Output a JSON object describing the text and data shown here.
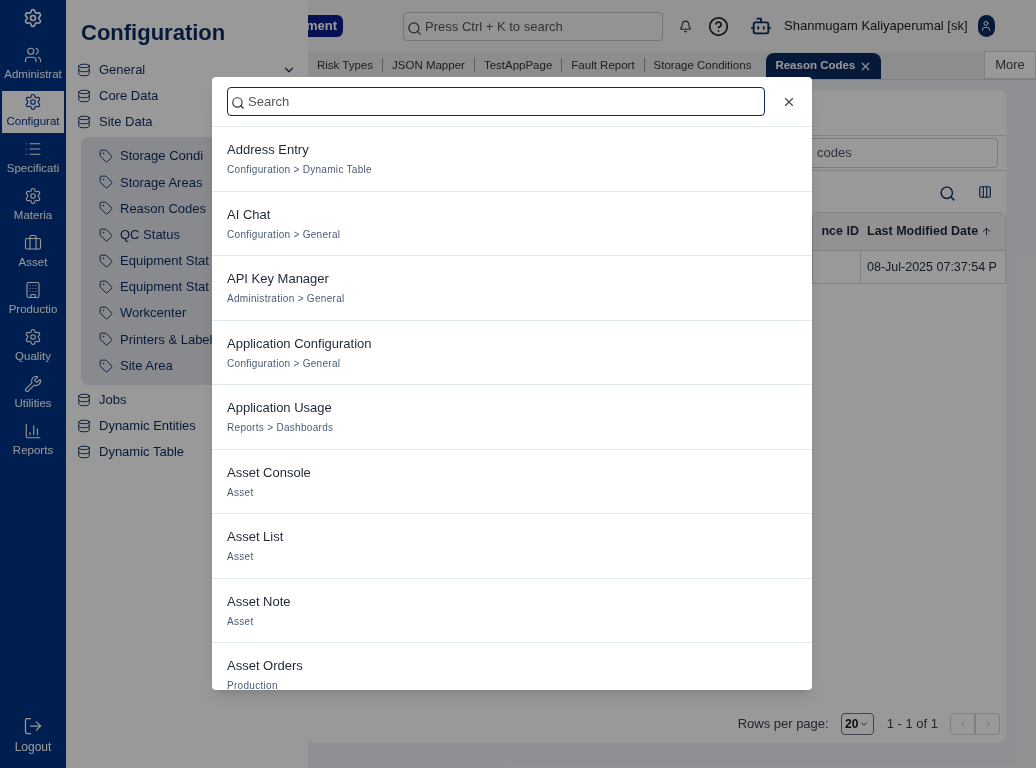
{
  "rail": {
    "items": [
      {
        "label": "Administrat",
        "selected": false
      },
      {
        "label": "Configurat",
        "selected": true
      },
      {
        "label": "Specificati",
        "selected": false
      },
      {
        "label": "Materia",
        "selected": false
      },
      {
        "label": "Asset",
        "selected": false
      },
      {
        "label": "Productio",
        "selected": false
      },
      {
        "label": "Quality",
        "selected": false
      },
      {
        "label": "Utilities",
        "selected": false
      },
      {
        "label": "Reports",
        "selected": false
      }
    ],
    "logout": "Logout"
  },
  "sidebar": {
    "title": "Configuration",
    "items": [
      {
        "label": "General",
        "expanded": false
      },
      {
        "label": "Core Data"
      },
      {
        "label": "Site Data",
        "expanded": true,
        "children": [
          "Storage Condi",
          "Storage Areas",
          "Reason Codes",
          "QC Status",
          "Equipment Stat",
          "Equipment Stat",
          "Workcenter",
          "Printers & Label",
          "Site Area"
        ]
      },
      {
        "label": "Jobs"
      },
      {
        "label": "Dynamic Entities"
      },
      {
        "label": "Dynamic Table"
      }
    ]
  },
  "header": {
    "badge": "ment",
    "search_placeholder": "Press Ctrl + K to search",
    "user": "Shanmugam Kaliyaperumal [sk]"
  },
  "tabs": [
    {
      "label": "Risk Types",
      "selected": false
    },
    {
      "label": "JSON Mapper",
      "selected": false
    },
    {
      "label": "TestAppPage",
      "selected": false
    },
    {
      "label": "Fault Report",
      "selected": false
    },
    {
      "label": "Storage Conditions",
      "selected": false
    },
    {
      "label": "Reason Codes",
      "selected": true
    }
  ],
  "more": "More",
  "content": {
    "search_value": "codes",
    "columns": [
      "nce ID",
      "Last Modified Date"
    ],
    "rows": [
      [
        "",
        "08-Jul-2025 07:37:54 P"
      ]
    ],
    "rows_per_page_label": "Rows per page:",
    "rows_per_page": "20",
    "range": "1 - 1 of 1"
  },
  "dialog": {
    "search_placeholder": "Search",
    "results": [
      {
        "title": "Address Entry",
        "path": "Configuration > Dynamic Table"
      },
      {
        "title": "AI Chat",
        "path": "Configuration > General"
      },
      {
        "title": "API Key Manager",
        "path": "Administration > General"
      },
      {
        "title": "Application Configuration",
        "path": "Configuration > General"
      },
      {
        "title": "Application Usage",
        "path": "Reports > Dashboards"
      },
      {
        "title": "Asset Console",
        "path": "Asset"
      },
      {
        "title": "Asset List",
        "path": "Asset"
      },
      {
        "title": "Asset Note",
        "path": "Asset"
      },
      {
        "title": "Asset Orders",
        "path": "Production"
      }
    ]
  }
}
